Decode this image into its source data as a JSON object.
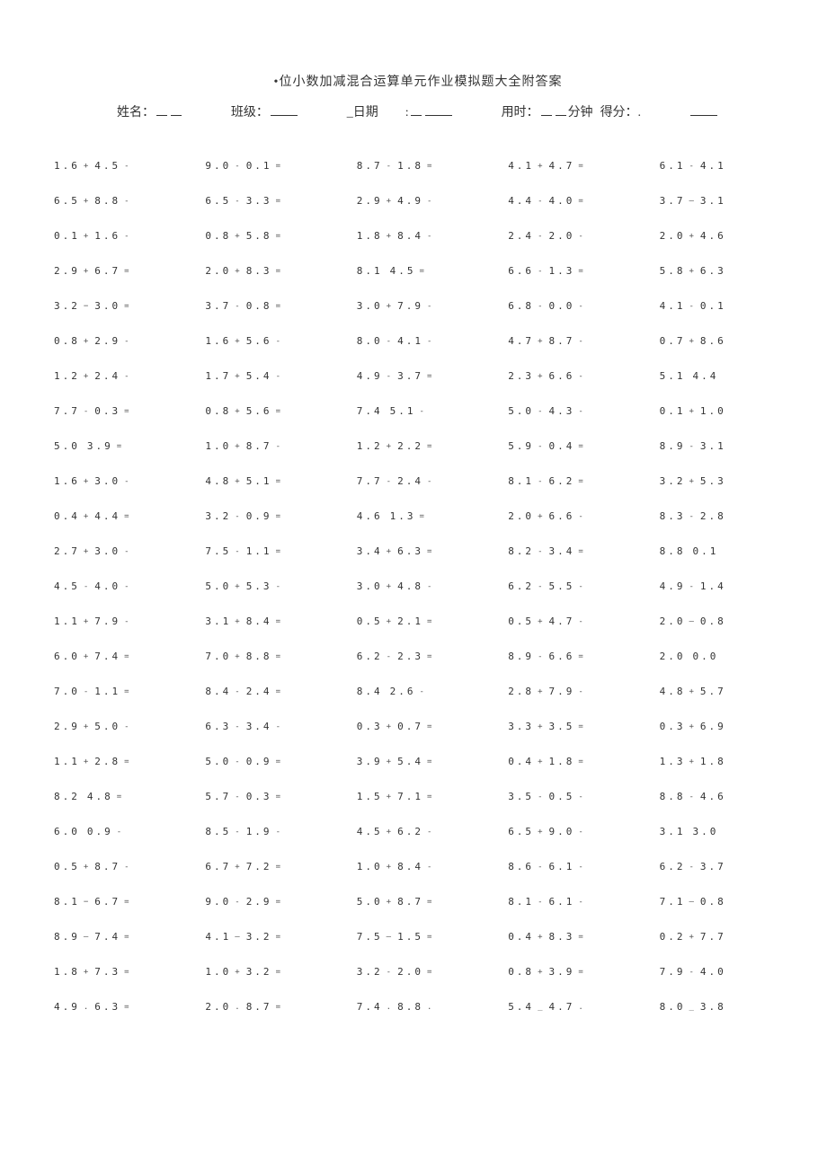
{
  "title": "•位小数加减混合运算单元作业模拟题大全附答案",
  "info": {
    "name_label": "姓名：",
    "class_label": "班级：",
    "date_label": "日期",
    "time_label_pre": "用时：",
    "time_label_post": "分钟",
    "score_label": "得分：."
  },
  "problems": [
    [
      {
        "a": "1.6",
        "op": "+",
        "b": "4.5",
        "e": "-"
      },
      {
        "a": "9.0",
        "op": "-",
        "b": "0.1",
        "e": "="
      },
      {
        "a": "8.7",
        "op": "-",
        "b": "1.8",
        "e": "="
      },
      {
        "a": "4.1",
        "op": "+",
        "b": "4.7",
        "e": "="
      },
      {
        "a": "6.1",
        "op": "-",
        "b": "4.1",
        "e": ""
      }
    ],
    [
      {
        "a": "6.5",
        "op": "+",
        "b": "8.8",
        "e": "-"
      },
      {
        "a": "6.5",
        "op": "-",
        "b": "3.3",
        "e": "="
      },
      {
        "a": "2.9",
        "op": "+",
        "b": "4.9",
        "e": "-"
      },
      {
        "a": "4.4",
        "op": "-",
        "b": "4.0",
        "e": "="
      },
      {
        "a": "3.7",
        "op": "—",
        "b": "3.1",
        "e": ""
      }
    ],
    [
      {
        "a": "0.1",
        "op": "+",
        "b": "1.6",
        "e": "-"
      },
      {
        "a": "0.8",
        "op": "+",
        "b": "5.8",
        "e": "="
      },
      {
        "a": "1.8",
        "op": "+",
        "b": "8.4",
        "e": "-"
      },
      {
        "a": "2.4",
        "op": "-",
        "b": "2.0",
        "e": "-"
      },
      {
        "a": "2.0",
        "op": "+",
        "b": "4.6",
        "e": ""
      }
    ],
    [
      {
        "a": "2.9",
        "op": "+",
        "b": "6.7",
        "e": "="
      },
      {
        "a": "2.0",
        "op": "+",
        "b": "8.3",
        "e": "="
      },
      {
        "a": "8.1",
        "op": "",
        "b": "4.5",
        "e": "="
      },
      {
        "a": "6.6",
        "op": "-",
        "b": "1.3",
        "e": "="
      },
      {
        "a": "5.8",
        "op": "+",
        "b": "6.3",
        "e": ""
      }
    ],
    [
      {
        "a": "3.2",
        "op": "−",
        "b": "3.0",
        "e": "="
      },
      {
        "a": "3.7",
        "op": "-",
        "b": "0.8",
        "e": "="
      },
      {
        "a": "3.0",
        "op": "+",
        "b": "7.9",
        "e": "-"
      },
      {
        "a": "6.8",
        "op": "-",
        "b": "0.0",
        "e": "-"
      },
      {
        "a": "4.1",
        "op": "-",
        "b": "0.1",
        "e": ""
      }
    ],
    [
      {
        "a": "0.8",
        "op": "+",
        "b": "2.9",
        "e": "-"
      },
      {
        "a": "1.6",
        "op": "+",
        "b": "5.6",
        "e": "-"
      },
      {
        "a": "8.0",
        "op": "-",
        "b": "4.1",
        "e": "-"
      },
      {
        "a": "4.7",
        "op": "+",
        "b": "8.7",
        "e": "-"
      },
      {
        "a": "0.7",
        "op": "+",
        "b": "8.6",
        "e": ""
      }
    ],
    [
      {
        "a": "1.2",
        "op": "+",
        "b": "2.4",
        "e": "-"
      },
      {
        "a": "1.7",
        "op": "+",
        "b": "5.4",
        "e": "-"
      },
      {
        "a": "4.9",
        "op": "-",
        "b": "3.7",
        "e": "="
      },
      {
        "a": "2.3",
        "op": "+",
        "b": "6.6",
        "e": "-"
      },
      {
        "a": "5.1",
        "op": "",
        "b": "4.4",
        "e": ""
      }
    ],
    [
      {
        "a": "7.7",
        "op": "-",
        "b": "0.3",
        "e": "="
      },
      {
        "a": "0.8",
        "op": "+",
        "b": "5.6",
        "e": "="
      },
      {
        "a": "7.4",
        "op": "",
        "b": "5.1",
        "e": "-"
      },
      {
        "a": "5.0",
        "op": "-",
        "b": "4.3",
        "e": "-"
      },
      {
        "a": "0.1",
        "op": "+",
        "b": "1.0",
        "e": ""
      }
    ],
    [
      {
        "a": "5.0",
        "op": "",
        "b": "3.9",
        "e": "="
      },
      {
        "a": "1.0",
        "op": "+",
        "b": "8.7",
        "e": "-"
      },
      {
        "a": "1.2",
        "op": "+",
        "b": "2.2",
        "e": "="
      },
      {
        "a": "5.9",
        "op": "-",
        "b": "0.4",
        "e": "="
      },
      {
        "a": "8.9",
        "op": "-",
        "b": "3.1",
        "e": ""
      }
    ],
    [
      {
        "a": "1.6",
        "op": "+",
        "b": "3.0",
        "e": "-"
      },
      {
        "a": "4.8",
        "op": "+",
        "b": "5.1",
        "e": "="
      },
      {
        "a": "7.7",
        "op": "-",
        "b": "2.4",
        "e": "-"
      },
      {
        "a": "8.1",
        "op": "-",
        "b": "6.2",
        "e": "="
      },
      {
        "a": "3.2",
        "op": "+",
        "b": "5.3",
        "e": ""
      }
    ],
    [
      {
        "a": "0.4",
        "op": "+",
        "b": "4.4",
        "e": "="
      },
      {
        "a": "3.2",
        "op": "-",
        "b": "0.9",
        "e": "="
      },
      {
        "a": "4.6",
        "op": "",
        "b": "1.3",
        "e": "="
      },
      {
        "a": "2.0",
        "op": "+",
        "b": "6.6",
        "e": "-"
      },
      {
        "a": "8.3",
        "op": "-",
        "b": "2.8",
        "e": ""
      }
    ],
    [
      {
        "a": "2.7",
        "op": "+",
        "b": "3.0",
        "e": "-"
      },
      {
        "a": "7.5",
        "op": "-",
        "b": "1.1",
        "e": "="
      },
      {
        "a": "3.4",
        "op": "+",
        "b": "6.3",
        "e": "="
      },
      {
        "a": "8.2",
        "op": "-",
        "b": "3.4",
        "e": "="
      },
      {
        "a": "8.8",
        "op": "",
        "b": "0.1",
        "e": ""
      }
    ],
    [
      {
        "a": "4.5",
        "op": "-",
        "b": "4.0",
        "e": "-"
      },
      {
        "a": "5.0",
        "op": "+",
        "b": "5.3",
        "e": "-"
      },
      {
        "a": "3.0",
        "op": "+",
        "b": "4.8",
        "e": "-"
      },
      {
        "a": "6.2",
        "op": "-",
        "b": "5.5",
        "e": "-"
      },
      {
        "a": "4.9",
        "op": "-",
        "b": "1.4",
        "e": ""
      }
    ],
    [
      {
        "a": "1.1",
        "op": "+",
        "b": "7.9",
        "e": "-"
      },
      {
        "a": "3.1",
        "op": "+",
        "b": "8.4",
        "e": "="
      },
      {
        "a": "0.5",
        "op": "+",
        "b": "2.1",
        "e": "="
      },
      {
        "a": "0.5",
        "op": "+",
        "b": "4.7",
        "e": "-"
      },
      {
        "a": "2.0",
        "op": "—",
        "b": "0.8",
        "e": ""
      }
    ],
    [
      {
        "a": "6.0",
        "op": "+",
        "b": "7.4",
        "e": "="
      },
      {
        "a": "7.0",
        "op": "+",
        "b": "8.8",
        "e": "="
      },
      {
        "a": "6.2",
        "op": "-",
        "b": "2.3",
        "e": "="
      },
      {
        "a": "8.9",
        "op": "-",
        "b": "6.6",
        "e": "="
      },
      {
        "a": "2.0",
        "op": "",
        "b": "0.0",
        "e": ""
      }
    ],
    [
      {
        "a": "7.0",
        "op": "-",
        "b": "1.1",
        "e": "="
      },
      {
        "a": "8.4",
        "op": "-",
        "b": "2.4",
        "e": "="
      },
      {
        "a": "8.4",
        "op": "",
        "b": "2.6",
        "e": "-"
      },
      {
        "a": "2.8",
        "op": "+",
        "b": "7.9",
        "e": "-"
      },
      {
        "a": "4.8",
        "op": "+",
        "b": "5.7",
        "e": ""
      }
    ],
    [
      {
        "a": "2.9",
        "op": "+",
        "b": "5.0",
        "e": "-"
      },
      {
        "a": "6.3",
        "op": "-",
        "b": "3.4",
        "e": "-"
      },
      {
        "a": "0.3",
        "op": "+",
        "b": "0.7",
        "e": "="
      },
      {
        "a": "3.3",
        "op": "+",
        "b": "3.5",
        "e": "="
      },
      {
        "a": "0.3",
        "op": "+",
        "b": "6.9",
        "e": ""
      }
    ],
    [
      {
        "a": "1.1",
        "op": "+",
        "b": "2.8",
        "e": "="
      },
      {
        "a": "5.0",
        "op": "-",
        "b": "0.9",
        "e": "="
      },
      {
        "a": "3.9",
        "op": "+",
        "b": "5.4",
        "e": "="
      },
      {
        "a": "0.4",
        "op": "+",
        "b": "1.8",
        "e": "="
      },
      {
        "a": "1.3",
        "op": "+",
        "b": "1.8",
        "e": ""
      }
    ],
    [
      {
        "a": "8.2",
        "op": "",
        "b": "4.8",
        "e": "="
      },
      {
        "a": "5.7",
        "op": "-",
        "b": "0.3",
        "e": "="
      },
      {
        "a": "1.5",
        "op": "+",
        "b": "7.1",
        "e": "="
      },
      {
        "a": "3.5",
        "op": "-",
        "b": "0.5",
        "e": "-"
      },
      {
        "a": "8.8",
        "op": "-",
        "b": "4.6",
        "e": ""
      }
    ],
    [
      {
        "a": "6.0",
        "op": "",
        "b": "0.9",
        "e": "-"
      },
      {
        "a": "8.5",
        "op": "-",
        "b": "1.9",
        "e": "-"
      },
      {
        "a": "4.5",
        "op": "+",
        "b": "6.2",
        "e": "-"
      },
      {
        "a": "6.5",
        "op": "+",
        "b": "9.0",
        "e": "-"
      },
      {
        "a": "3.1",
        "op": "",
        "b": "3.0",
        "e": ""
      }
    ],
    [
      {
        "a": "0.5",
        "op": "+",
        "b": "8.7",
        "e": "-"
      },
      {
        "a": "6.7",
        "op": "+",
        "b": "7.2",
        "e": "="
      },
      {
        "a": "1.0",
        "op": "+",
        "b": "8.4",
        "e": "-"
      },
      {
        "a": "8.6",
        "op": "-",
        "b": "6.1",
        "e": "-"
      },
      {
        "a": "6.2",
        "op": "-",
        "b": "3.7",
        "e": ""
      }
    ],
    [
      {
        "a": "8.1",
        "op": "−",
        "b": "6.7",
        "e": "="
      },
      {
        "a": "9.0",
        "op": "-",
        "b": "2.9",
        "e": "="
      },
      {
        "a": "5.0",
        "op": "+",
        "b": "8.7",
        "e": "="
      },
      {
        "a": "8.1",
        "op": "-",
        "b": "6.1",
        "e": "-"
      },
      {
        "a": "7.1",
        "op": "—",
        "b": "0.8",
        "e": ""
      }
    ],
    [
      {
        "a": "8.9",
        "op": "—",
        "b": "7.4",
        "e": "="
      },
      {
        "a": "4.1",
        "op": "—",
        "b": "3.2",
        "e": "="
      },
      {
        "a": "7.5",
        "op": "—",
        "b": "1.5",
        "e": "="
      },
      {
        "a": "0.4",
        "op": "+",
        "b": "8.3",
        "e": "="
      },
      {
        "a": "0.2",
        "op": "+",
        "b": "7.7",
        "e": ""
      }
    ],
    [
      {
        "a": "1.8",
        "op": "+",
        "b": "7.3",
        "e": "="
      },
      {
        "a": "1.0",
        "op": "+",
        "b": "3.2",
        "e": "="
      },
      {
        "a": "3.2",
        "op": "-",
        "b": "2.0",
        "e": "="
      },
      {
        "a": "0.8",
        "op": "+",
        "b": "3.9",
        "e": "="
      },
      {
        "a": "7.9",
        "op": "-",
        "b": "4.0",
        "e": ""
      }
    ],
    [
      {
        "a": "4.9",
        "op": ".",
        "b": "6.3",
        "e": "="
      },
      {
        "a": "2.0",
        "op": ".",
        "b": "8.7",
        "e": "="
      },
      {
        "a": "7.4",
        "op": ".",
        "b": "8.8",
        "e": "."
      },
      {
        "a": "5.4",
        "op": "_",
        "b": "4.7",
        "e": "."
      },
      {
        "a": "8.0",
        "op": "_",
        "b": "3.8",
        "e": ""
      }
    ]
  ]
}
